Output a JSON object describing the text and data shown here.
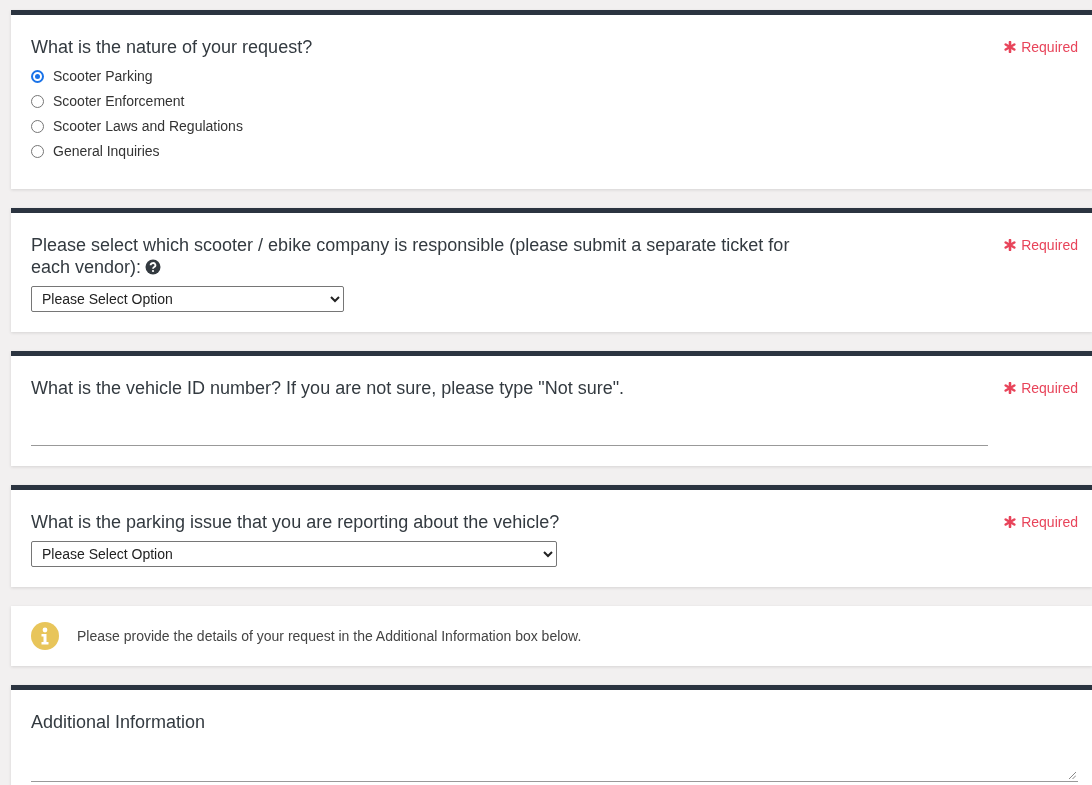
{
  "questions": [
    {
      "kind": "radio",
      "label": "What is the nature of your request?",
      "required_label": "Required",
      "options": [
        {
          "label": "Scooter Parking",
          "selected": true
        },
        {
          "label": "Scooter Enforcement",
          "selected": false
        },
        {
          "label": "Scooter Laws and Regulations",
          "selected": false
        },
        {
          "label": "General Inquiries",
          "selected": false
        }
      ]
    },
    {
      "kind": "select",
      "label": "Please select which scooter / ebike company is responsible (please submit a separate ticket for each vendor):",
      "help": true,
      "required_label": "Required",
      "value": "Please Select Option"
    },
    {
      "kind": "text",
      "label": "What is the vehicle ID number? If you are not sure, please type \"Not sure\".",
      "required_label": "Required"
    },
    {
      "kind": "select",
      "label": "What is the parking issue that you are reporting about the vehicle?",
      "required_label": "Required",
      "value": "Please Select Option"
    },
    {
      "kind": "info",
      "text": "Please provide the details of your request in the Additional Information box below."
    },
    {
      "kind": "textarea",
      "label": "Additional Information"
    }
  ]
}
